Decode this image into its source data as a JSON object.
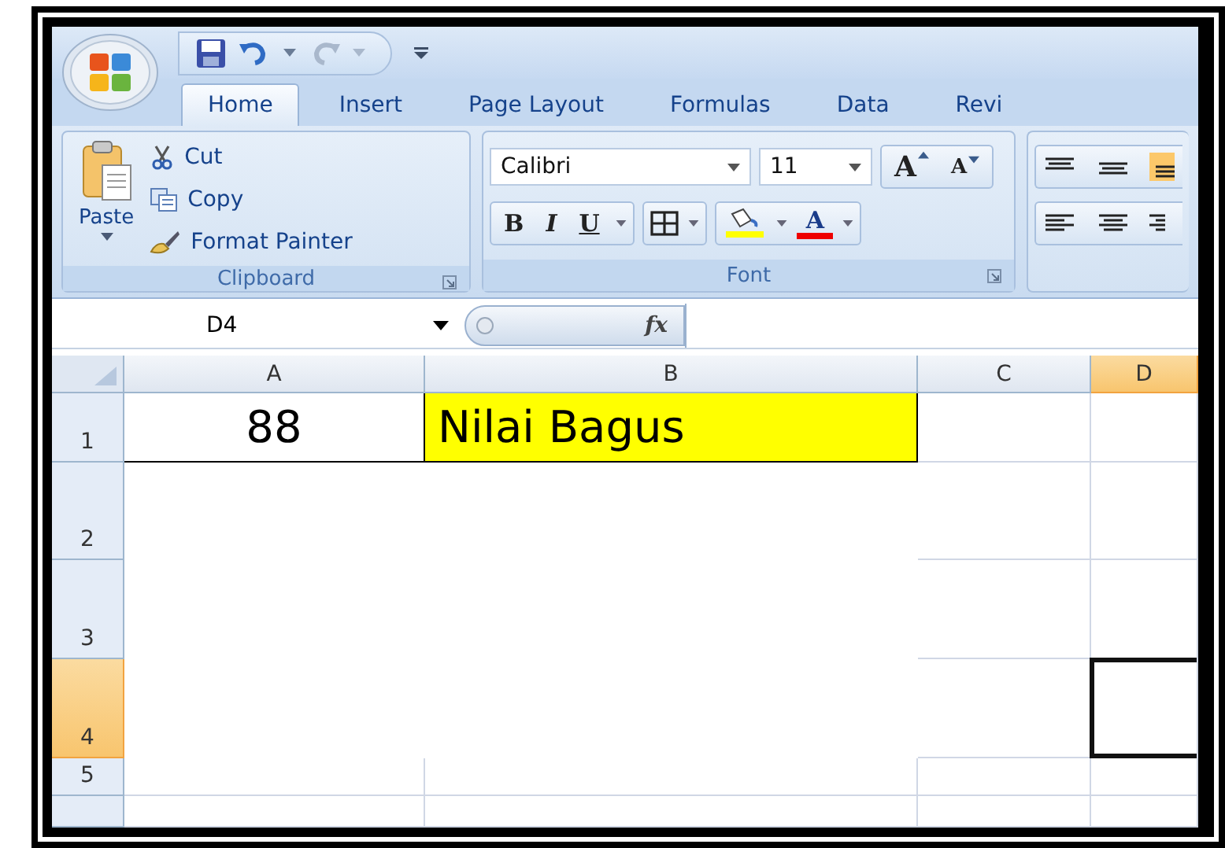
{
  "tabs": [
    {
      "label": "Home",
      "selected": true
    },
    {
      "label": "Insert",
      "selected": false
    },
    {
      "label": "Page Layout",
      "selected": false
    },
    {
      "label": "Formulas",
      "selected": false
    },
    {
      "label": "Data",
      "selected": false
    },
    {
      "label": "Revi",
      "selected": false
    }
  ],
  "clipboard": {
    "paste": "Paste",
    "cut": "Cut",
    "copy": "Copy",
    "format_painter": "Format Painter",
    "label": "Clipboard"
  },
  "font": {
    "name": "Calibri",
    "size": "11",
    "grow": "A",
    "shrink": "A",
    "bold": "B",
    "italic": "I",
    "underline": "U",
    "font_color": "A",
    "label": "Font"
  },
  "name_box": "D4",
  "fx": "fx",
  "columns": [
    {
      "label": "A",
      "selected": false
    },
    {
      "label": "B",
      "selected": false
    },
    {
      "label": "C",
      "selected": false
    },
    {
      "label": "D",
      "selected": true
    }
  ],
  "rows": [
    {
      "label": "1",
      "selected": false,
      "cells": [
        {
          "value": "88",
          "kind": "number",
          "highlighted": false
        },
        {
          "value": "Nilai Bagus",
          "kind": "text",
          "highlighted": true
        }
      ]
    },
    {
      "label": "2",
      "selected": false
    },
    {
      "label": "3",
      "selected": false
    },
    {
      "label": "4",
      "selected": true
    },
    {
      "label": "5",
      "selected": false
    }
  ]
}
